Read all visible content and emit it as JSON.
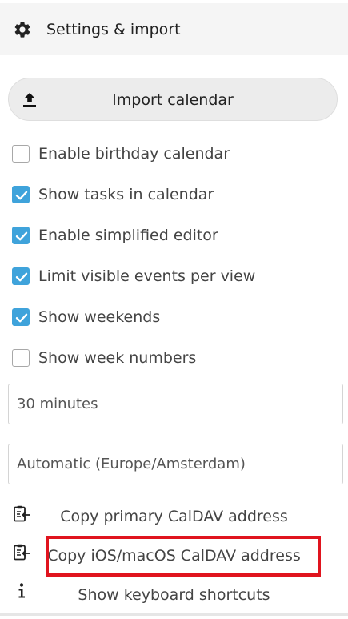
{
  "header": {
    "icon": "gear-icon",
    "title": "Settings & import"
  },
  "import_button": {
    "icon": "upload-icon",
    "label": "Import calendar"
  },
  "options": [
    {
      "label": "Enable birthday calendar",
      "checked": false
    },
    {
      "label": "Show tasks in calendar",
      "checked": true
    },
    {
      "label": "Enable simplified editor",
      "checked": true
    },
    {
      "label": "Limit visible events per view",
      "checked": true
    },
    {
      "label": "Show weekends",
      "checked": true
    },
    {
      "label": "Show week numbers",
      "checked": false
    }
  ],
  "time_slot_select": {
    "value": "30 minutes"
  },
  "timezone_select": {
    "value": "Automatic (Europe/Amsterdam)"
  },
  "actions": [
    {
      "icon": "clipboard-copy-icon",
      "label": "Copy primary CalDAV address"
    },
    {
      "icon": "clipboard-copy-icon",
      "label": "Copy iOS/macOS CalDAV address",
      "highlighted": true
    },
    {
      "icon": "info-icon",
      "label": "Show keyboard shortcuts"
    }
  ],
  "colors": {
    "accent": "#3fa3db",
    "highlight": "#e0141e"
  }
}
